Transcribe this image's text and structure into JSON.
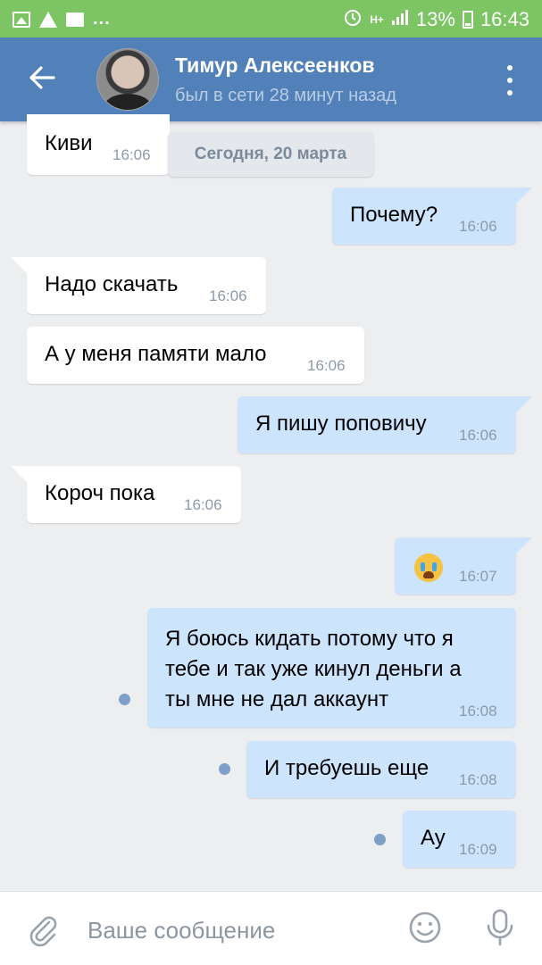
{
  "status_bar": {
    "icons_left": [
      "image-icon",
      "warning-icon",
      "chat-icon"
    ],
    "dots": "...",
    "signal": "H+",
    "battery": "13%",
    "time": "16:43"
  },
  "header": {
    "name": "Тимур Алексеенков",
    "status": "был в сети 28 минут назад"
  },
  "date_divider": "Сегодня, 20 марта",
  "messages": [
    {
      "dir": "in",
      "text": "Киви",
      "time": "16:06"
    },
    {
      "dir": "out",
      "text": "Почему?",
      "time": "16:06"
    },
    {
      "dir": "in",
      "text": "Надо скачать",
      "time": "16:06"
    },
    {
      "dir": "in",
      "text": "А у меня памяти мало",
      "time": "16:06"
    },
    {
      "dir": "out",
      "text": "Я пишу поповичу",
      "time": "16:06"
    },
    {
      "dir": "in",
      "text": "Короч пока",
      "time": "16:06"
    },
    {
      "dir": "out",
      "text": "",
      "emoji": "crying-face",
      "time": "16:07"
    },
    {
      "dir": "out",
      "lines": [
        "Я боюсь кидать потому что я",
        "тебе и так уже кинул деньги а",
        "ты мне не дал аккаунт"
      ],
      "time": "16:08",
      "unread": true
    },
    {
      "dir": "out",
      "text": "И требуешь еще",
      "time": "16:08",
      "unread": true
    },
    {
      "dir": "out",
      "text": "Ау",
      "time": "16:09",
      "unread": true
    }
  ],
  "input": {
    "placeholder": "Ваше сообщение",
    "value": ""
  },
  "colors": {
    "status_bar": "#7cc464",
    "header": "#5181b8",
    "incoming_bubble": "#ffffff",
    "outgoing_bubble": "#cce4fc",
    "background": "#edeef0"
  }
}
